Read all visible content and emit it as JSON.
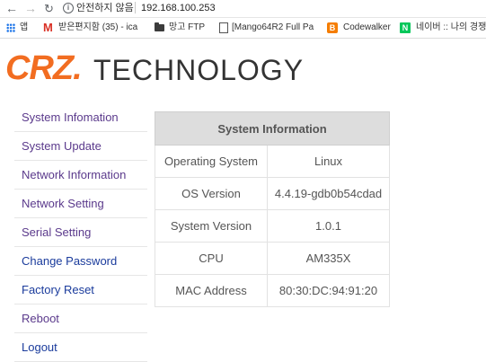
{
  "browser": {
    "security_label": "안전하지 않음",
    "url": "192.168.100.253",
    "bookmarks": [
      {
        "label": "앱"
      },
      {
        "label": "받은편지함 (35) - ica"
      },
      {
        "label": "망고 FTP"
      },
      {
        "label": "[Mango64R2 Full Pa"
      },
      {
        "label": "Codewalker"
      },
      {
        "label": "네이버 :: 나의 경쟁"
      }
    ]
  },
  "logo": {
    "crz": "CRZ.",
    "technology": "TECHNOLOGY"
  },
  "sidebar": {
    "items": [
      {
        "label": "System Infomation"
      },
      {
        "label": "System Update"
      },
      {
        "label": "Network Information"
      },
      {
        "label": "Network Setting"
      },
      {
        "label": "Serial Setting"
      },
      {
        "label": "Change Password"
      },
      {
        "label": "Factory Reset"
      },
      {
        "label": "Reboot"
      },
      {
        "label": "Logout"
      }
    ]
  },
  "system_info": {
    "title": "System Information",
    "rows": [
      {
        "key": "Operating System",
        "value": "Linux"
      },
      {
        "key": "OS Version",
        "value": "4.4.19-gdb0b54cdad"
      },
      {
        "key": "System Version",
        "value": "1.0.1"
      },
      {
        "key": "CPU",
        "value": "AM335X"
      },
      {
        "key": "MAC Address",
        "value": "80:30:DC:94:91:20"
      }
    ]
  }
}
